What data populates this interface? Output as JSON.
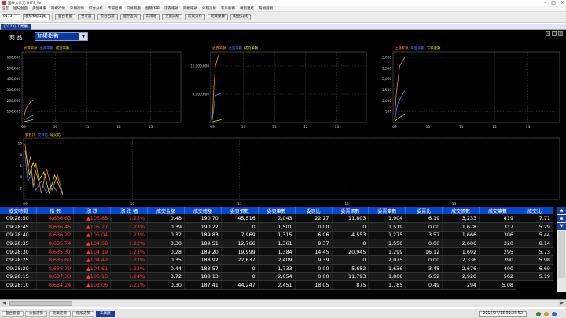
{
  "window": {
    "title": "國泰大三元 [HTS_9x]"
  },
  "menu": [
    "設定",
    "國紀盤面",
    "多盤專欄",
    "期權行情",
    "外期行情",
    "綜合分析",
    "市場結構",
    "交易期歷",
    "盤簡下單",
    "證券帳號",
    "期權帳號",
    "外期交易",
    "客戶服務",
    "視窗連結",
    "幫視說明"
  ],
  "toolbar": {
    "symbol_input": "0173",
    "select_value": "證券市場工具",
    "buttons": [
      "盤台看盤",
      "整存器",
      "雪台回補",
      "優存查詢",
      "朱雨唯",
      "交割試驗",
      "前案分析",
      "期貨變權",
      "點金公式"
    ]
  },
  "doc_tab": "[0173] 工業廳",
  "product": {
    "label": "商 品",
    "value": "加權指數"
  },
  "colors": {
    "accent": "#0a47c8",
    "up": "#ff3b3b",
    "header_bg": "#0a47c8"
  },
  "charts": {
    "c1": {
      "legend": [
        "委賣筆數",
        "委買筆數",
        "成交筆數"
      ],
      "y_ticks": [
        "600,000",
        "500,000",
        "400,000",
        "300,000",
        "200,000",
        "100,000"
      ],
      "x_ticks": [
        "09",
        "10",
        "11",
        "12",
        "13"
      ]
    },
    "c2": {
      "legend": [
        "委賣筆數",
        "委買筆數",
        "成交筆數"
      ],
      "y_ticks": [
        "10,000,000",
        "5,000,000"
      ],
      "x_ticks": [
        "09",
        "10",
        "11",
        "12",
        "13"
      ]
    },
    "c3": {
      "legend": [
        "上漲家數",
        "平盤家數",
        "下跌家數"
      ],
      "y_ticks": [
        "3,000",
        "2,500",
        "2,000",
        "1,500",
        "1,000",
        "500"
      ],
      "x_ticks": [
        "09",
        "10",
        "11",
        "12",
        "13"
      ]
    },
    "c4": {
      "legend": [
        "委買比",
        "委賣比",
        "成交比"
      ],
      "y_ticks": [
        "10",
        "8",
        "6",
        "4",
        "2"
      ],
      "x_ticks": [
        "09",
        "10",
        "11",
        "12",
        "13"
      ]
    }
  },
  "table": {
    "columns": [
      "成交時間",
      "指 數",
      "漲 跌",
      "漲 跌 幅",
      "成交金額",
      "成交總額",
      "委買張數",
      "委買筆數",
      "委買比",
      "委賣張數",
      "委賣筆數",
      "委賣比",
      "成交張數",
      "成交筆數",
      "成交比"
    ],
    "rows": [
      [
        "09:28:50",
        "8,636.63",
        "▲105.85",
        "1.23%",
        "0.48",
        "190.70",
        "45,516",
        "2,043",
        "22.27",
        "11,803",
        "1,904",
        "6.19",
        "3,233",
        "419",
        "7.71"
      ],
      [
        "09:28:45",
        "8,636.45",
        "▲105.27",
        "1.23%",
        "0.39",
        "190.22",
        "0",
        "1,501",
        "0.00",
        "0",
        "1,519",
        "0.00",
        "1,678",
        "317",
        "5.29"
      ],
      [
        "09:28:40",
        "8,636.22",
        "▲105.04",
        "1.23%",
        "0.32",
        "189.83",
        "7,969",
        "1,315",
        "6.06",
        "4,553",
        "1,275",
        "3.57",
        "1,666",
        "306",
        "5.44"
      ],
      [
        "09:28:35",
        "8,635.74",
        "▲104.56",
        "1.22%",
        "0.30",
        "189.51",
        "12,766",
        "1,361",
        "9.37",
        "0",
        "1,550",
        "0.00",
        "2,606",
        "320",
        "8.14"
      ],
      [
        "09:28:30",
        "8,635.37",
        "▲104.19",
        "1.22%",
        "0.28",
        "189.20",
        "19,999",
        "1,384",
        "14.45",
        "20,945",
        "1,299",
        "16.12",
        "1,692",
        "295",
        "5.73"
      ],
      [
        "09:28:25",
        "8,635.60",
        "▲104.42",
        "1.22%",
        "0.35",
        "188.92",
        "22,637",
        "2,409",
        "9.39",
        "0",
        "2,075",
        "0.00",
        "2,336",
        "390",
        "5.98"
      ],
      [
        "09:28:20",
        "8,635.79",
        "▲104.61",
        "1.22%",
        "0.44",
        "188.57",
        "0",
        "1,733",
        "0.00",
        "5,652",
        "1,636",
        "3.45",
        "2,676",
        "400",
        "6.69"
      ],
      [
        "09:28:15",
        "8,637.33",
        "▲106.15",
        "1.24%",
        "0.72",
        "188.13",
        "0",
        "2,054",
        "0.00",
        "11,793",
        "1,808",
        "6.52",
        "2,920",
        "562",
        "5.19"
      ],
      [
        "09:28:10",
        "8,634.24",
        "▲103.06",
        "1.21%",
        "0.30",
        "187.41",
        "44,247",
        "2,451",
        "18.05",
        "875",
        "1,785",
        "0.49",
        "294",
        "5.08"
      ]
    ]
  },
  "status": {
    "tabs": [
      "盤台看盤",
      "大盤走勢",
      "期貨走勢",
      "個股走勢",
      "工業廳"
    ],
    "active_index": 4,
    "datetime": "2016/04/13 09:28:52"
  }
}
